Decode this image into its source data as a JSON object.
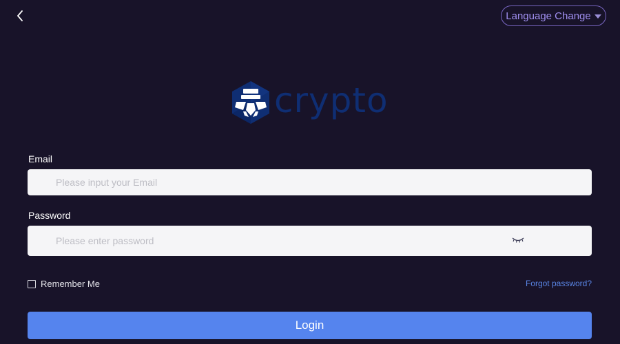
{
  "header": {
    "back_icon": "chevron-left-icon",
    "language_label": "Language Change",
    "language_icon": "caret-down-icon"
  },
  "logo": {
    "text": "crypto",
    "icon": "crypto-lion-icon",
    "color": "#0f2e73"
  },
  "form": {
    "email_label": "Email",
    "email_placeholder": "Please input your Email",
    "email_value": "",
    "password_label": "Password",
    "password_placeholder": "Please enter password",
    "password_value": "",
    "password_toggle_icon": "eye-closed-icon",
    "remember_label": "Remember Me",
    "remember_checked": false,
    "forgot_label": "Forgot password?",
    "login_label": "Login"
  },
  "colors": {
    "background": "#181329",
    "accent": "#5584ee",
    "language_border": "#7a67c4",
    "link": "#5a86e6"
  }
}
